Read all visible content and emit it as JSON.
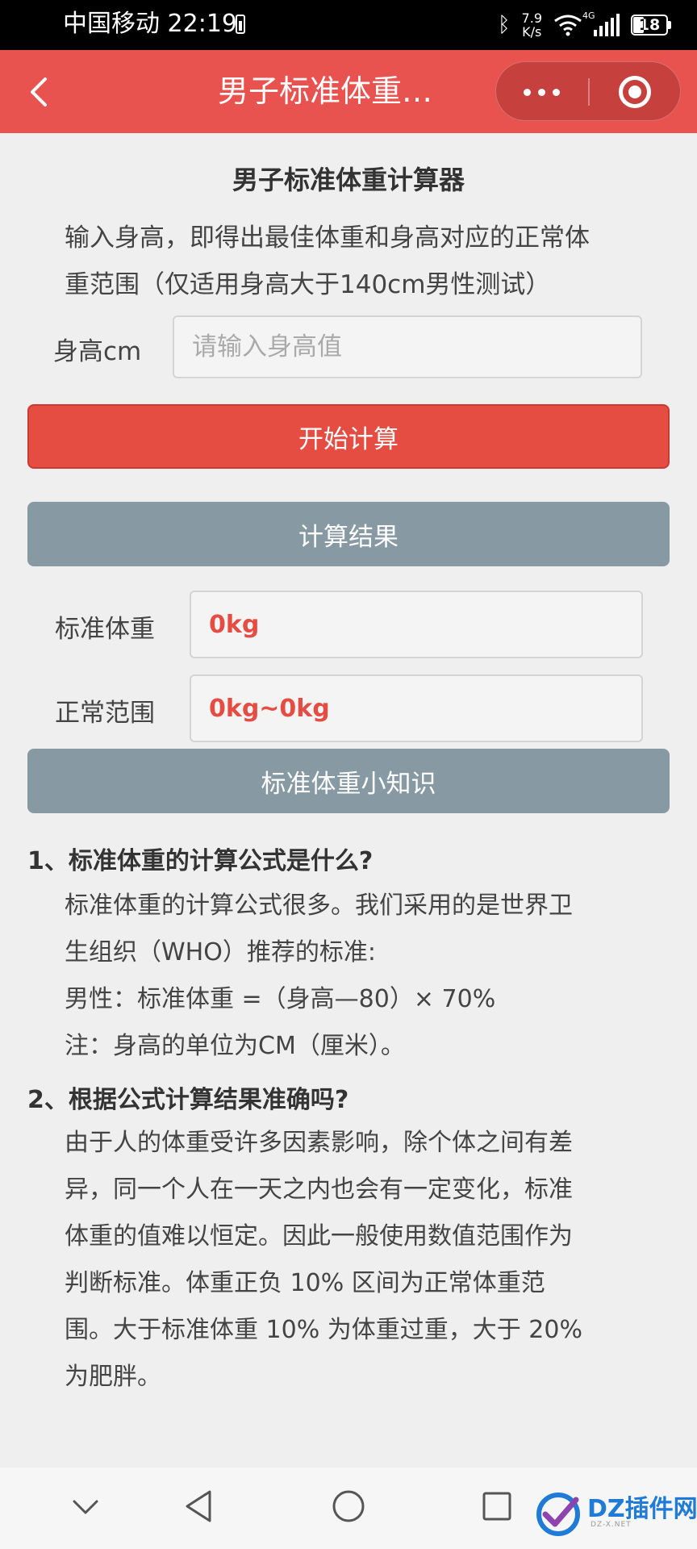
{
  "status_bar": {
    "carrier_time": "中国移动 22:19",
    "speed_value": "7.9",
    "speed_unit": "K/s",
    "network_type": "4G",
    "battery": "18"
  },
  "nav": {
    "title": "男子标准体重…"
  },
  "calculator": {
    "title": "男子标准体重计算器",
    "intro_line1": "输入身高，即得出最佳体重和身高对应的正常体",
    "intro_line2": "重范围（仅适用身高大于140cm男性测试）",
    "height_label": "身高cm",
    "height_value": "",
    "height_placeholder": "请输入身高值",
    "calc_button": "开始计算"
  },
  "results": {
    "header": "计算结果",
    "standard_label": "标准体重",
    "standard_value": "0kg",
    "range_label": "正常范围",
    "range_value": "0kg~0kg"
  },
  "knowledge": {
    "header": "标准体重小知识",
    "q1": "1、标准体重的计算公式是什么?",
    "q1_lines": [
      "标准体重的计算公式很多。我们采用的是世界卫",
      "生组织（WHO）推荐的标准:",
      "男性：标准体重 =（身高—80）× 70%",
      "注：身高的单位为CM（厘米）。"
    ],
    "q2": "2、根据公式计算结果准确吗?",
    "q2_lines": [
      "由于人的体重受许多因素影响，除个体之间有差",
      "异，同一个人在一天之内也会有一定变化，标准",
      "体重的值难以恒定。因此一般使用数值范围作为",
      "判断标准。体重正负 10% 区间为正常体重范",
      "围。大于标准体重 10% 为体重过重，大于 20%",
      "为肥胖。"
    ]
  },
  "watermark": {
    "text": "DZ插件网",
    "sub": "DZ-X.NET"
  }
}
